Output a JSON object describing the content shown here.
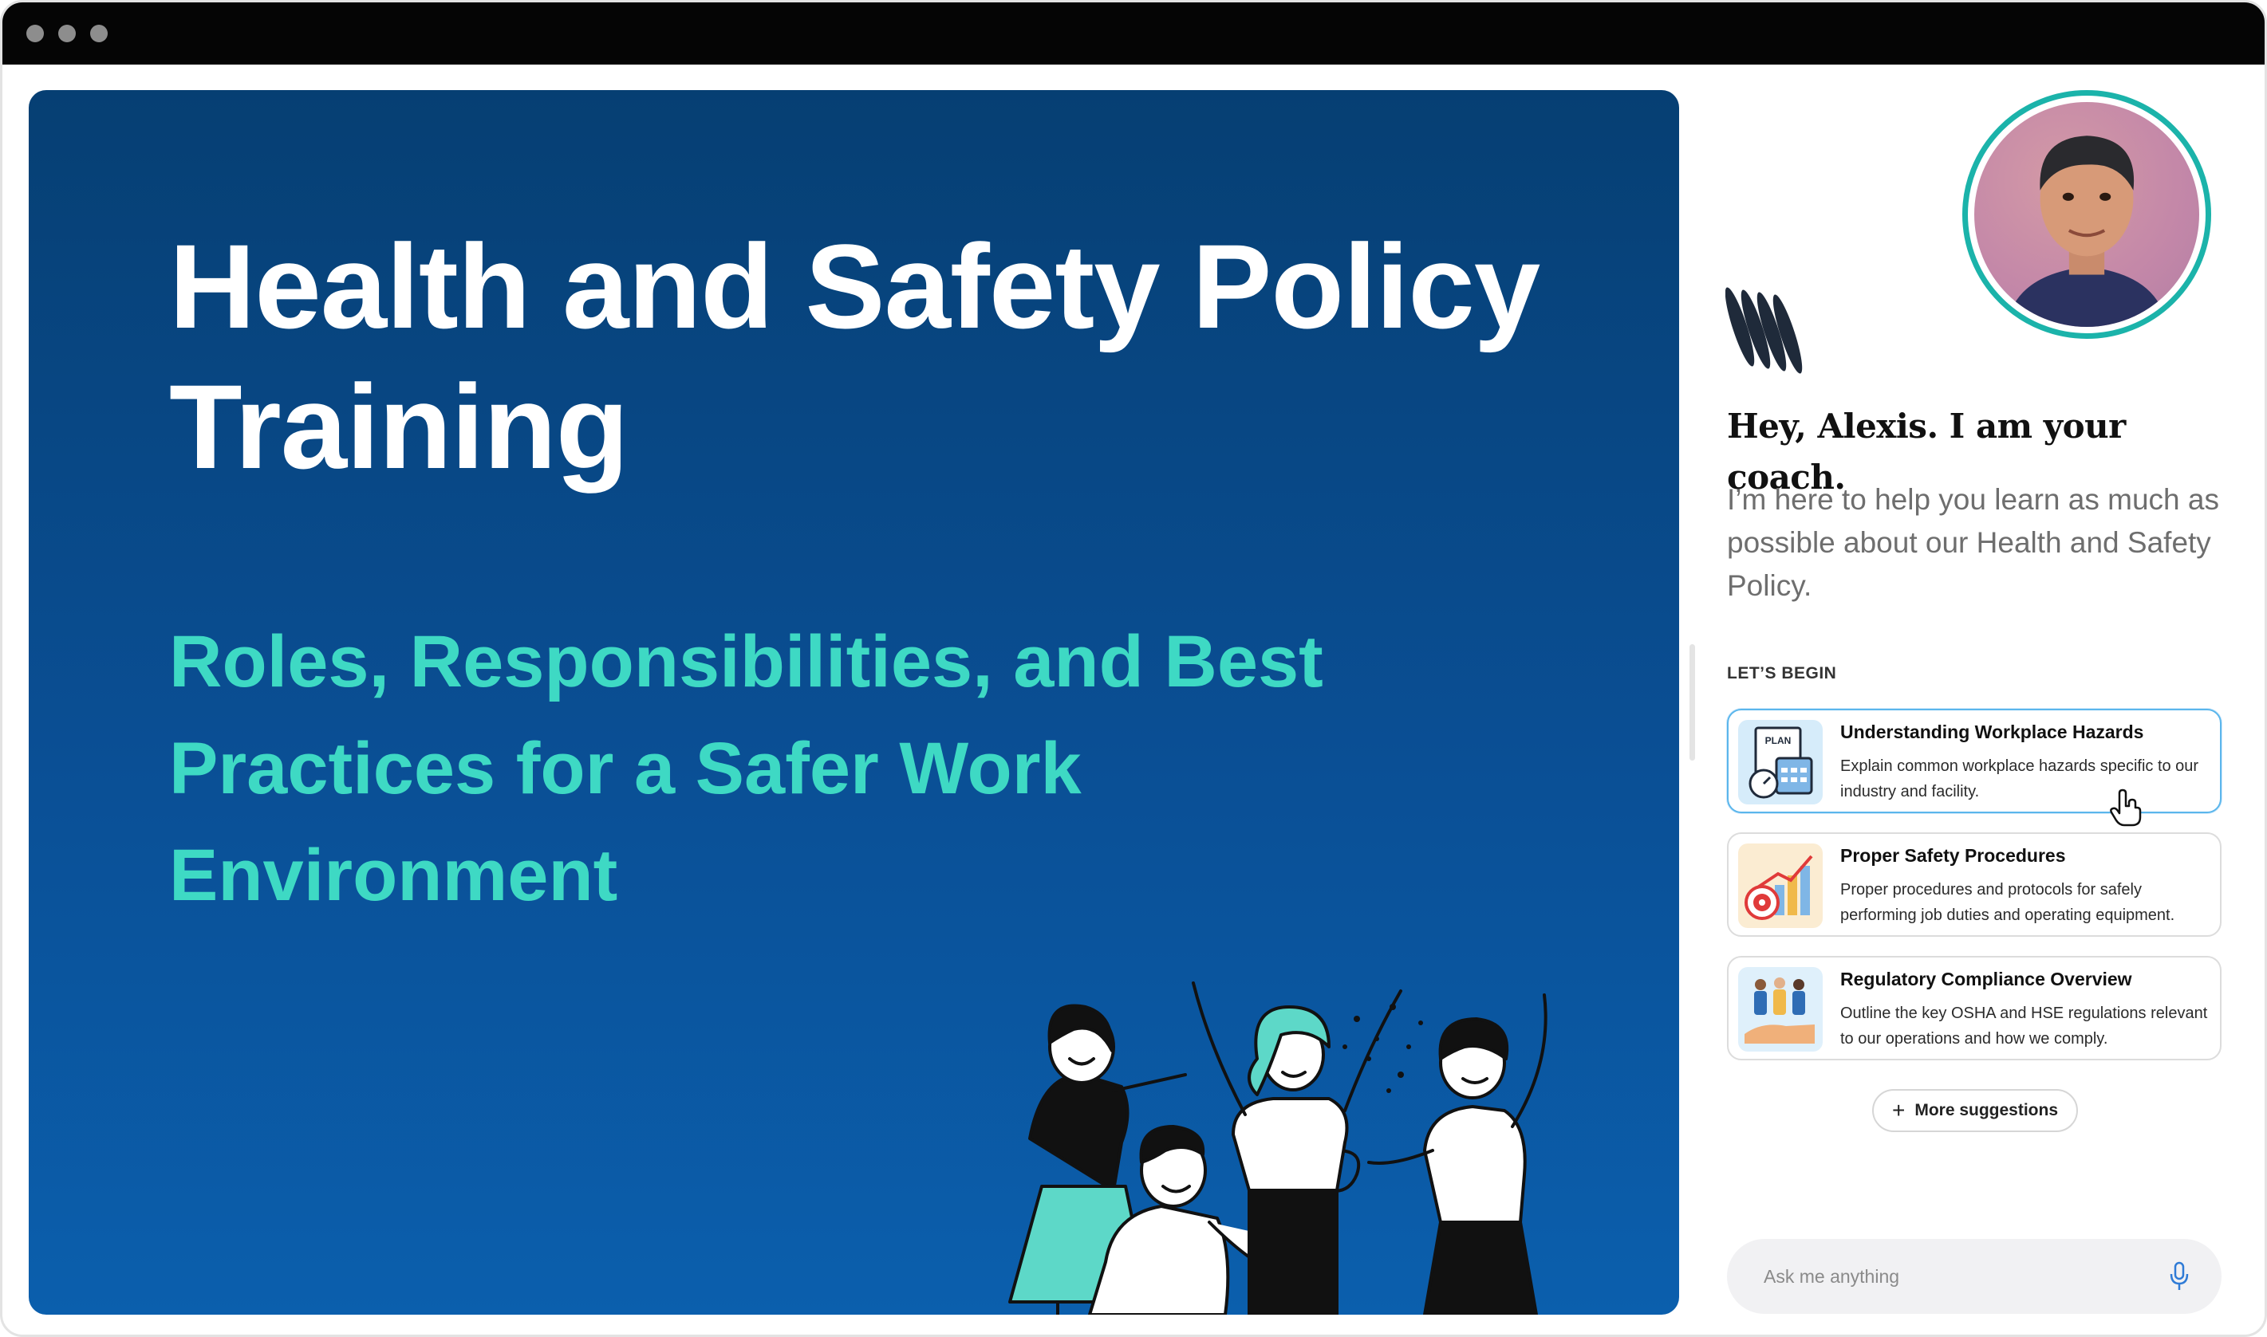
{
  "slide": {
    "title": "Health and Safety Policy Training",
    "subtitle": "Roles, Responsibilities, and Best Practices for a Safer Work Environment"
  },
  "coach": {
    "greeting": "Hey, Alexis. I am your coach.",
    "intro": "I’m here to help you learn as much as possible about our Health and Safety Policy."
  },
  "section_label": "LET’S BEGIN",
  "suggestions": [
    {
      "title": "Understanding Workplace Hazards",
      "description": "Explain common workplace hazards specific to our industry and facility.",
      "icon": "plan-clipboard-icon",
      "thumb_text": "PLAN"
    },
    {
      "title": "Proper Safety Procedures",
      "description": "Proper procedures and protocols for safely performing job duties and operating equipment.",
      "icon": "target-chart-icon"
    },
    {
      "title": "Regulatory Compliance Overview",
      "description": "Outline the key OSHA and HSE regulations relevant to our operations and how we comply.",
      "icon": "team-hand-icon"
    }
  ],
  "more_suggestions": "More suggestions",
  "ask": {
    "placeholder": "Ask me anything"
  },
  "colors": {
    "slide_bg_top": "#063f73",
    "slide_bg_bottom": "#0b5fad",
    "subtitle": "#3ed9c4",
    "avatar_ring": "#1bb3aa",
    "active_border": "#5bb6ec"
  }
}
